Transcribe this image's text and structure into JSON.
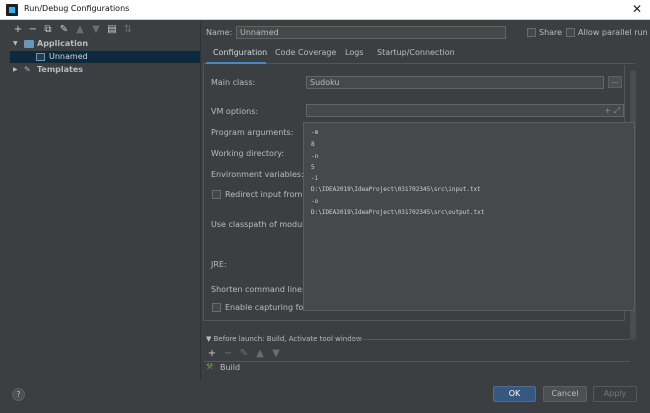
{
  "window": {
    "title": "Run/Debug Configurations",
    "close_glyph": "✕"
  },
  "left_toolbar": {
    "icons": [
      "add-icon",
      "remove-icon",
      "copy-icon",
      "wrench-icon",
      "move-up-icon",
      "move-down-icon",
      "folder-icon",
      "sort-icon"
    ],
    "glyphs": {
      "add": "+",
      "remove": "−",
      "copy": "⧉",
      "wrench": "✎",
      "up": "▲",
      "down": "▼",
      "folder": "▤",
      "sort": "⇅"
    }
  },
  "tree": {
    "application_label": "Application",
    "unnamed_label": "Unnamed",
    "templates_label": "Templates",
    "expanded_arrow": "▼",
    "collapsed_arrow": "▶",
    "templates_icon": "🔧"
  },
  "header": {
    "name_label": "Name:",
    "name_value": "Unnamed",
    "share_label": "Share",
    "allow_parallel_label": "Allow parallel run"
  },
  "tabs": [
    {
      "label": "Configuration",
      "active": true
    },
    {
      "label": "Code Coverage",
      "active": false
    },
    {
      "label": "Logs",
      "active": false
    },
    {
      "label": "Startup/Connection",
      "active": false
    }
  ],
  "form": {
    "main_class_label": "Main class:",
    "main_class_value": "Sudoku",
    "main_class_browse": "...",
    "vm_options_label": "VM options:",
    "vm_expand": "+ ⤢",
    "program_args_label": "Program arguments:",
    "working_dir_label": "Working directory:",
    "env_vars_label": "Environment variables:",
    "redirect_label": "Redirect input from:",
    "classpath_label": "Use classpath of module:",
    "jre_label": "JRE:",
    "shorten_label": "Shorten command line:",
    "capturing_label": "Enable capturing form"
  },
  "program_arguments_popup": {
    "lines": [
      "-m",
      "8",
      "-n",
      "5",
      "-i",
      "D:\\IDEA2019\\IdeaProject\\031702345\\src\\input.txt",
      "-o",
      "D:\\IDEA2019\\IdeaProject\\031702345\\src\\output.txt"
    ]
  },
  "before_launch": {
    "header": "Before launch: Build, Activate tool window",
    "toolbar": {
      "add": "+",
      "remove": "−",
      "edit": "✎",
      "up": "▲",
      "down": "▼"
    },
    "items": [
      "Build"
    ]
  },
  "buttons": {
    "help": "?",
    "ok": "OK",
    "cancel": "Cancel",
    "apply": "Apply"
  },
  "colors": {
    "background": "#3c3f41",
    "selection": "#0d293e",
    "accent": "#4a88c7",
    "ok_button": "#365880"
  }
}
